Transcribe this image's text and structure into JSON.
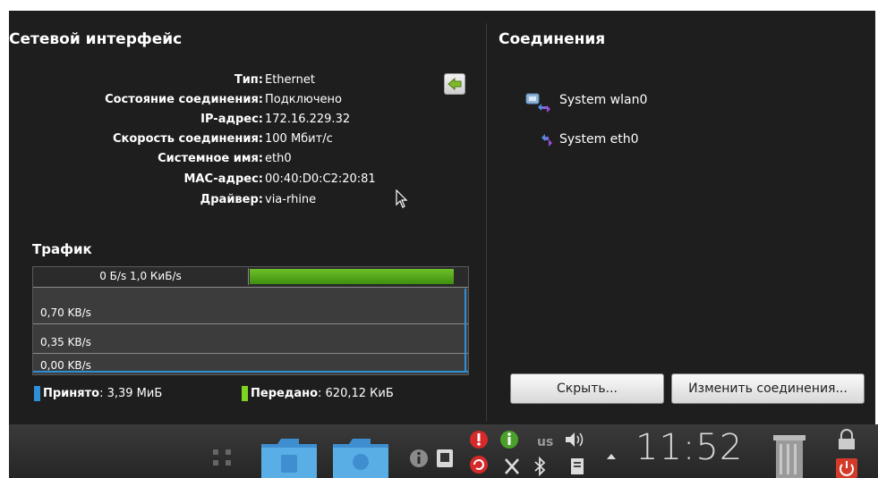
{
  "interface": {
    "title": "Сетевой интерфейс",
    "rows": [
      {
        "key": "Тип",
        "value": "Ethernet"
      },
      {
        "key": "Состояние соединения",
        "value": "Подключено"
      },
      {
        "key": "IP-адрес",
        "value": "172.16.229.32"
      },
      {
        "key": "Скорость соединения",
        "value": "100 Мбит/с"
      },
      {
        "key": "Системное имя",
        "value": "eth0"
      },
      {
        "key": "MAC-адрес",
        "value": "00:40:D0:C2:20:81"
      },
      {
        "key": "Драйвер",
        "value": "via-rhine"
      }
    ],
    "colon": ":"
  },
  "traffic": {
    "title": "Трафик",
    "rate_label": "0 Б/s 1,0 КиБ/s",
    "sent_bar_fraction": 0.96,
    "axis_labels": [
      "0,70 KB/s",
      "0,35 KB/s",
      "0,00 KB/s"
    ],
    "legend": {
      "received_key": "Принято",
      "received_value": ": 3,39 МиБ",
      "received_color": "#2f8fd6",
      "sent_key": "Передано",
      "sent_value": ": 620,12 КиБ",
      "sent_color": "#7ed321"
    }
  },
  "connections": {
    "title": "Соединения",
    "items": [
      {
        "label": "System wlan0",
        "icon": "wireless-connection-icon"
      },
      {
        "label": "System eth0",
        "icon": "wired-connection-icon"
      }
    ]
  },
  "buttons": {
    "hide": "Скрыть...",
    "edit": "Изменить соединения..."
  },
  "taskbar": {
    "clock": "11:52",
    "keyboard_layout": "us",
    "icons": [
      "menu-dots-icon",
      "folder-documents-icon",
      "folder-downloads-icon",
      "info-icon",
      "network-icon",
      "alert-icon",
      "update-icon",
      "reload-icon",
      "network-tools-icon",
      "bluetooth-icon",
      "volume-icon",
      "clipboard-icon",
      "expand-arrow-icon",
      "trash-icon",
      "lock-icon",
      "power-icon"
    ]
  }
}
